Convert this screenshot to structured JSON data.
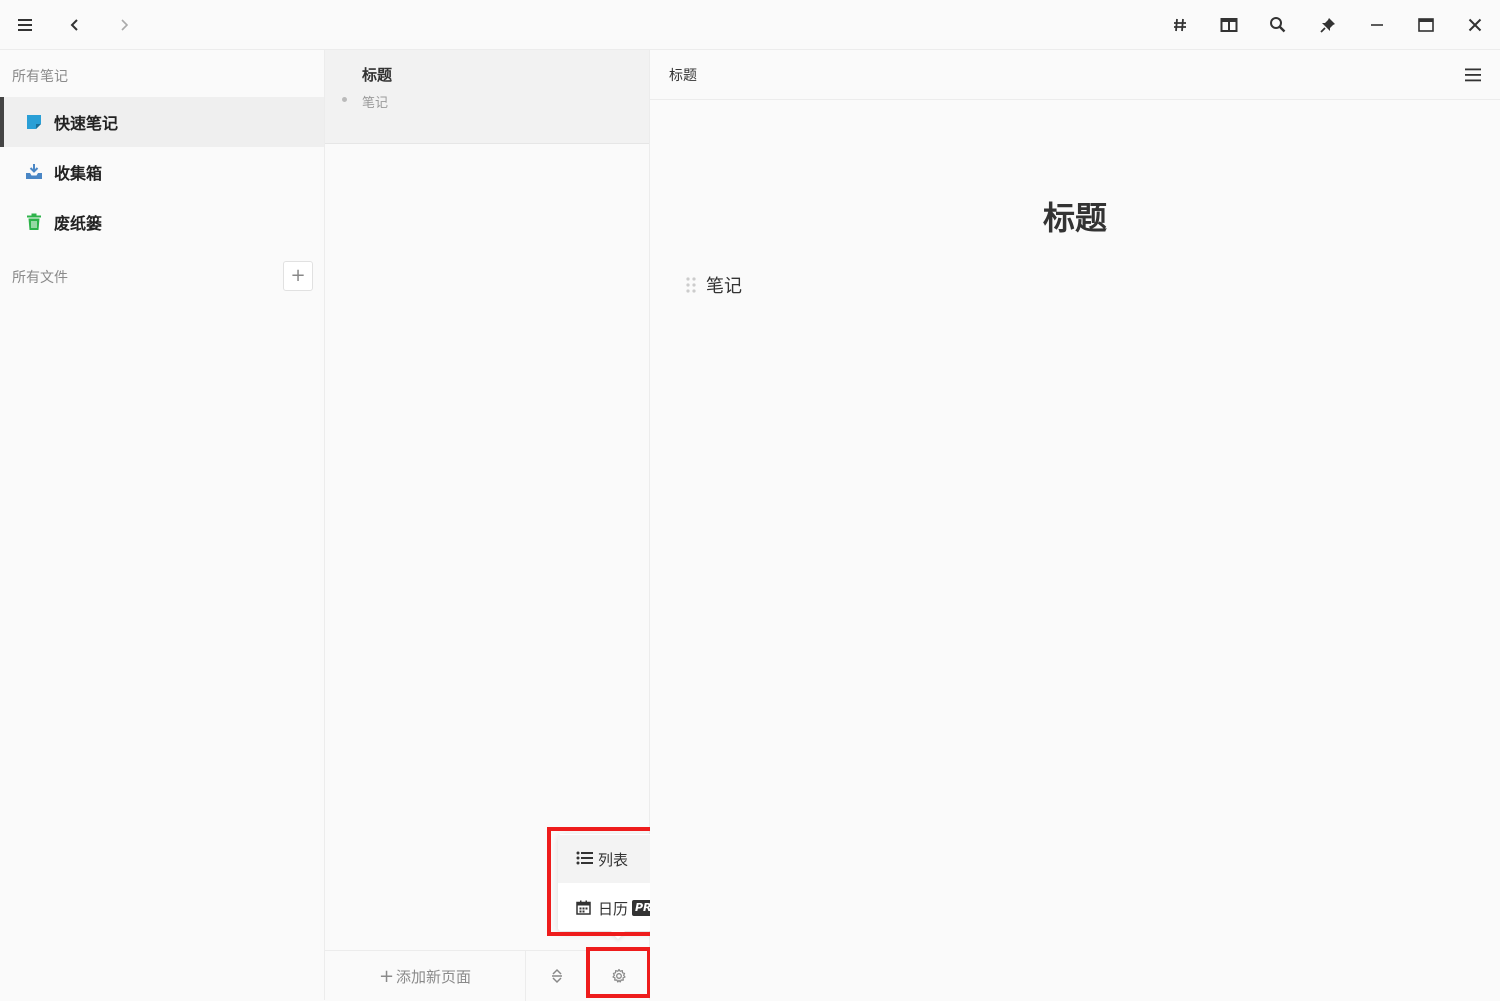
{
  "colors": {
    "accent_red": "#ee1c1c",
    "quick_note_icon": "#2a9fd6",
    "inbox_icon": "#4a86c5",
    "trash_icon": "#2db34a"
  },
  "sidebar": {
    "all_notes_header": "所有笔记",
    "items": [
      {
        "label": "快速笔记",
        "icon": "note-icon",
        "active": true
      },
      {
        "label": "收集箱",
        "icon": "inbox-icon",
        "active": false
      },
      {
        "label": "废纸篓",
        "icon": "trash-icon",
        "active": false
      }
    ],
    "all_files_header": "所有文件",
    "add_label": "+"
  },
  "list": {
    "note": {
      "title": "标题",
      "snippet": "笔记"
    },
    "footer": {
      "add_page_label": "添加新页面",
      "add_page_plus": "+"
    }
  },
  "popup": {
    "items": [
      {
        "label": "列表",
        "icon": "list-icon"
      },
      {
        "label": "日历",
        "icon": "calendar-icon",
        "badge": "PRO"
      }
    ]
  },
  "editor": {
    "breadcrumb": "标题",
    "doc_title": "标题",
    "block_text": "笔记"
  }
}
